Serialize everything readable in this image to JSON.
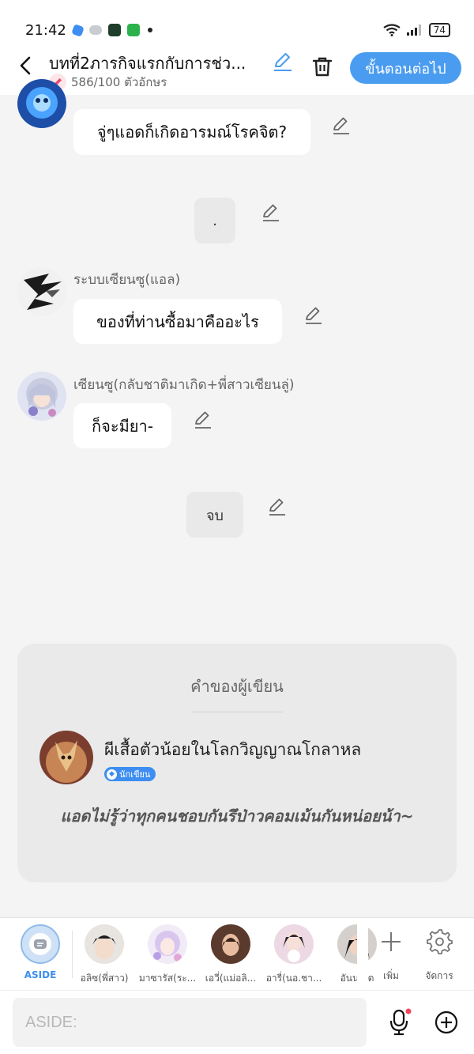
{
  "status": {
    "time": "21:42",
    "battery": "74",
    "colors": {
      "app1": "#3d8ef0",
      "app2": "#9aa0a6",
      "app3": "#1f3d2b",
      "app4": "#2bb24c"
    }
  },
  "header": {
    "title": "บทที่2ภารกิจแรกกับการช่ว...",
    "char_count": "586/100 ตัวอักษร",
    "next_button": "ขั้นตอนต่อไป",
    "accent": "#4a9cf0"
  },
  "messages": [
    {
      "type": "dialogue",
      "speaker": "",
      "text": "จู่ๆแอดก็เกิดอารมณ์โรคจิต?",
      "avatar": "blue-creature"
    },
    {
      "type": "narration",
      "text": "."
    },
    {
      "type": "dialogue",
      "speaker": "ระบบเซียนซู(แอล)",
      "text": "ของที่ท่านซื้อมาคืออะไร",
      "avatar": "ink-sketch"
    },
    {
      "type": "dialogue",
      "speaker": "เซียนซู(กลับชาติมาเกิด+พี่สาวเซียนลู่)",
      "text": "ก็จะมียา-",
      "avatar": "silver-hair-girl"
    },
    {
      "type": "narration",
      "text": "จบ"
    }
  ],
  "author_note": {
    "heading": "คำของผู้เขียน",
    "author": "ผีเสื้อตัวน้อยในโลกวิญญาณโกลาหล",
    "badge": "นักเขียน",
    "text": "แอดไม่รู้ว่าทุกคนชอบกันรึป่าวคอมเม้นกันหน่อยน้า~"
  },
  "characters": {
    "aside_label": "ASIDE",
    "items": [
      {
        "name": "อลิซ(พี่สาว)",
        "avatar": "dark-hair-boy"
      },
      {
        "name": "มาซารัส(ระ...",
        "avatar": "lilac-hair-girl"
      },
      {
        "name": "เอวี่(แม่อลิ...",
        "avatar": "brown-hair-woman"
      },
      {
        "name": "อารี่(นอ.ชา...",
        "avatar": "girl-with-cat"
      },
      {
        "name": "อันนา(ต",
        "avatar": "black-hair-girl"
      }
    ],
    "add_label": "เพิ่ม",
    "manage_label": "จัดการ"
  },
  "input": {
    "placeholder": "ASIDE:"
  }
}
